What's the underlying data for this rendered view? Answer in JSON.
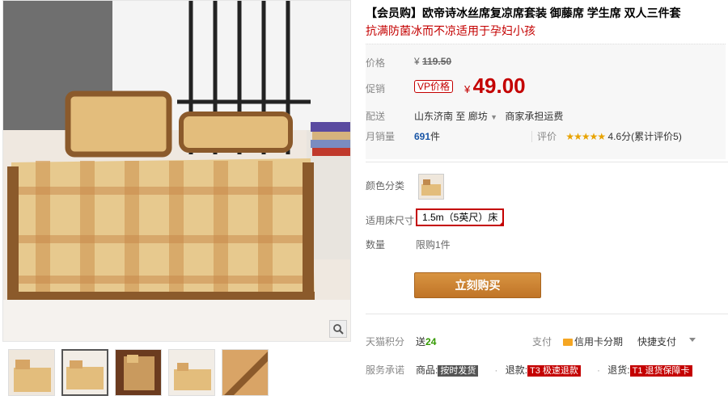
{
  "product": {
    "title": "【会员购】欧帝诗冰丝席复凉席套装 御藤席 学生席 双人三件套",
    "subtitle": "抗满防菌冰而不凉适用于孕妇小孩"
  },
  "price_panel": {
    "orig_label": "价格",
    "orig_currency": "¥",
    "orig_value": "119.50",
    "promo_label": "促销",
    "vip_badge": "VP价格",
    "promo_currency": "¥",
    "promo_value": "49.00",
    "ship_label": "配送",
    "ship_from": "山东济南",
    "ship_to_word": "至",
    "ship_to": "廊坊",
    "ship_note": "商家承担运费",
    "sales_label": "月销量",
    "sales_count": "691",
    "sales_unit": "件",
    "rating_label": "评价",
    "rating_stars": "★★★★★",
    "rating_text": "4.6分(累计评价5)"
  },
  "sku": {
    "color_label": "颜色分类",
    "size_label": "适用床尺寸",
    "size_selected": "1.5m（5英尺）床",
    "qty_label": "数量",
    "qty_limit": "限购1件"
  },
  "buy_button": "立刻购买",
  "extras": {
    "points_label": "天猫积分",
    "points_prefix": "送",
    "points_value": "24",
    "pay_label": "支付",
    "credit_label": "信用卡分期",
    "quick_pay": "快捷支付",
    "promise_label": "服务承诺",
    "promise_1_text": "商品:",
    "promise_1_tag": "按时发货",
    "promise_2_text": "退款:",
    "promise_2_tag": "T3 极速退款",
    "promise_3_text": "退货:",
    "promise_3_tag": "T1 退货保障卡"
  },
  "colors": {
    "accent": "#c40000",
    "buy": "#c98231"
  },
  "icons": {
    "zoom": "magnifier-icon",
    "card": "credit-card-icon"
  }
}
